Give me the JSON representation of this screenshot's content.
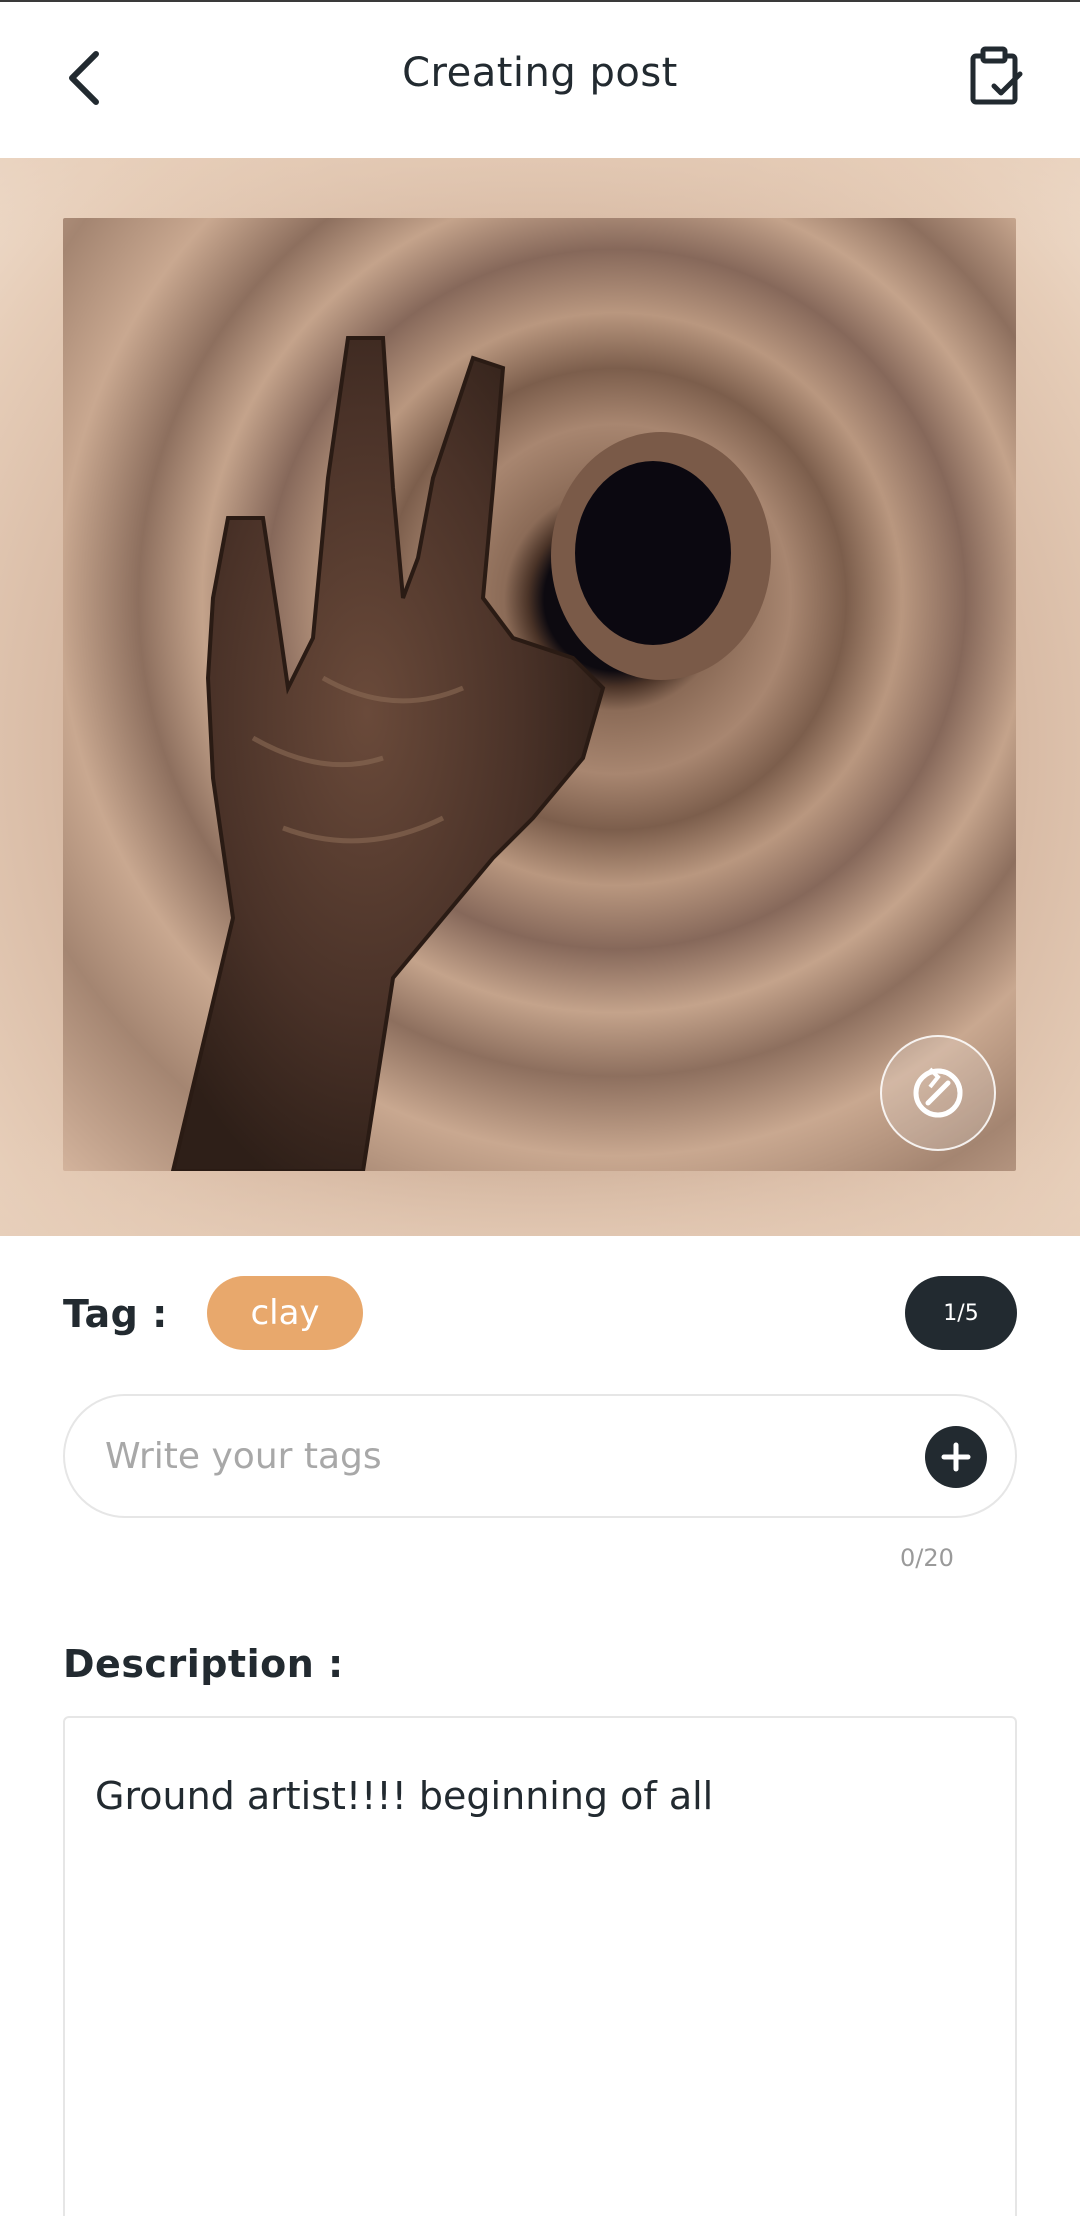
{
  "header": {
    "title": "Creating post",
    "back_icon": "chevron-left-icon",
    "done_icon": "clipboard-check-icon"
  },
  "image": {
    "rotate_icon": "rotate-icon"
  },
  "tags": {
    "label": "Tag :",
    "items": [
      "clay"
    ],
    "page_indicator": "1/5",
    "input_placeholder": "Write your tags",
    "input_value": "",
    "add_icon": "plus-icon",
    "char_counter": "0/20"
  },
  "description": {
    "label": "Description :",
    "text": "Ground artist!!!! beginning of all"
  },
  "colors": {
    "accent": "#e8a86c",
    "dark": "#222a30",
    "muted": "#a8a8a8"
  }
}
